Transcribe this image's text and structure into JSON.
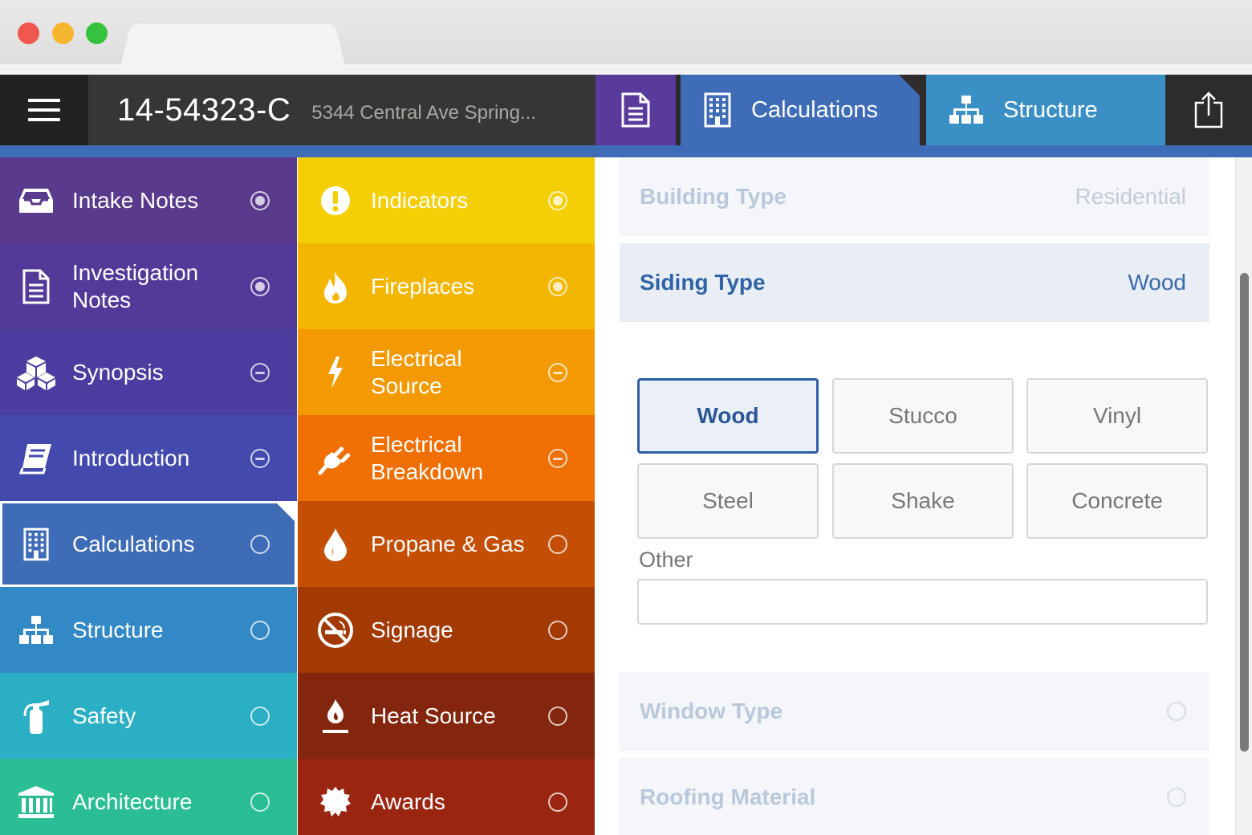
{
  "header": {
    "case_id": "14-54323-C",
    "address": "5344 Central Ave Spring...",
    "tabs": [
      {
        "label": "Calculations",
        "icon": "building-icon",
        "color": "#3f6cb7"
      },
      {
        "label": "Structure",
        "icon": "org-chart-icon",
        "color": "#3a8fc4"
      }
    ]
  },
  "nav_left": [
    {
      "label": "Intake Notes",
      "icon": "inbox-icon",
      "status": "filled",
      "color": "#593a8c"
    },
    {
      "label": "Investigation Notes",
      "icon": "document-icon",
      "status": "filled",
      "color": "#533a99"
    },
    {
      "label": "Synopsis",
      "icon": "cubes-icon",
      "status": "half",
      "color": "#4a3d9f"
    },
    {
      "label": "Introduction",
      "icon": "book-icon",
      "status": "half",
      "color": "#4349ad"
    },
    {
      "label": "Calculations",
      "icon": "building-icon",
      "status": "empty",
      "color": "#3f6cb7",
      "active": true
    },
    {
      "label": "Structure",
      "icon": "org-chart-icon",
      "status": "empty",
      "color": "#3289c5"
    },
    {
      "label": "Safety",
      "icon": "fire-extinguisher-icon",
      "status": "empty",
      "color": "#2bafc4"
    },
    {
      "label": "Architecture",
      "icon": "bank-icon",
      "status": "empty",
      "color": "#2bbe94"
    }
  ],
  "nav_right": [
    {
      "label": "Indicators",
      "icon": "exclamation-icon",
      "status": "filled",
      "color": "#f5cf06"
    },
    {
      "label": "Fireplaces",
      "icon": "flame-icon",
      "status": "filled",
      "color": "#f4b701"
    },
    {
      "label": "Electrical Source",
      "icon": "lightning-icon",
      "status": "half",
      "color": "#f39a02"
    },
    {
      "label": "Electrical Breakdown",
      "icon": "plug-icon",
      "status": "half",
      "color": "#ef6f02"
    },
    {
      "label": "Propane & Gas",
      "icon": "gas-drop-icon",
      "status": "empty",
      "color": "#c44e03"
    },
    {
      "label": "Signage",
      "icon": "no-smoking-icon",
      "status": "empty",
      "color": "#a33903"
    },
    {
      "label": "Heat Source",
      "icon": "candle-icon",
      "status": "empty",
      "color": "#84250d"
    },
    {
      "label": "Awards",
      "icon": "award-badge-icon",
      "status": "empty",
      "color": "#9a2612"
    }
  ],
  "form": {
    "building_type": {
      "label": "Building Type",
      "value": "Residential"
    },
    "siding_type": {
      "label": "Siding Type",
      "value": "Wood"
    },
    "siding_options": [
      "Wood",
      "Stucco",
      "Vinyl",
      "Steel",
      "Shake",
      "Concrete"
    ],
    "selected_option": "Wood",
    "other_label": "Other",
    "other_value": "",
    "window_type": {
      "label": "Window Type"
    },
    "roofing_material": {
      "label": "Roofing Material"
    }
  }
}
